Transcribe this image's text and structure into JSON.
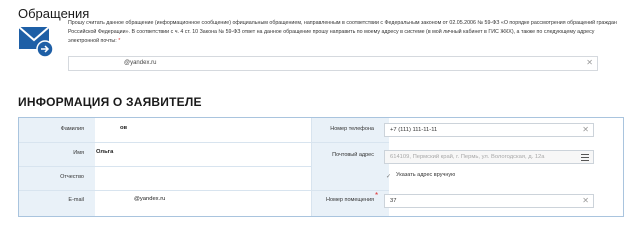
{
  "appeal": {
    "title": "Обращения",
    "consent_text": "Прошу считать данное обращение (информационное сообщение) официальным обращением, направленным в соответствии с Федеральным законом от 02.05.2006 № 59-ФЗ «О порядке рассмотрения обращений граждан Российской Федерации». В соответствии с ч. 4 ст. 10 Закона № 59-ФЗ ответ на данное обращение прошу направить по моему адресу в системе (в мой личный кабинет в ГИС ЖКХ), а также по следующему адресу электронной почты:",
    "required_mark": "*",
    "email_value": "@yandex.ru",
    "clear_glyph": "✕"
  },
  "applicant": {
    "title": "ИНФОРМАЦИЯ О ЗАЯВИТЕЛЕ",
    "surname_label": "Фамилия",
    "surname_value": "ов",
    "name_label": "Имя",
    "name_value": "Ольга",
    "patronymic_label": "Отчество",
    "patronymic_value": "",
    "email_label": "E-mail",
    "email_value": "@yandex.ru",
    "phone_label": "Номер телефона",
    "phone_value": "+7 (111) 111-11-11",
    "address_label": "Почтовый адрес",
    "address_value": "614109, Пермский край, г. Пермь, ул. Вологодская, д. 12а",
    "manual_address_label": "Указать адрес вручную",
    "manual_address_checked": true,
    "room_label": "Номер помещения",
    "room_required_mark": "*",
    "room_value": "37"
  },
  "icons": {
    "mail": "mail-reply-icon",
    "clear": "close-icon",
    "menu": "hamburger-icon",
    "check": "checkmark-icon"
  },
  "colors": {
    "icon_blue": "#1e5fa6",
    "panel_border": "#a9c4de",
    "label_bg": "#e9f1f8",
    "required": "#dd3333"
  }
}
